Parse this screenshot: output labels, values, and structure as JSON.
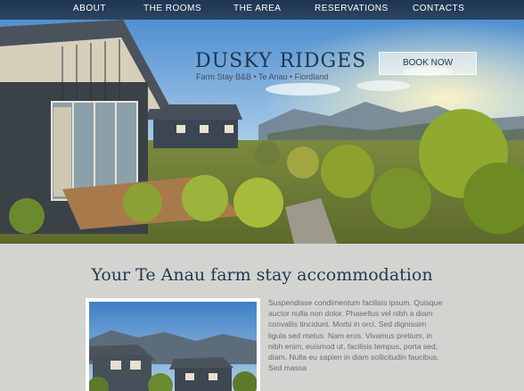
{
  "nav": {
    "items": [
      {
        "label": "ABOUT"
      },
      {
        "label": "THE ROOMS"
      },
      {
        "label": "THE AREA"
      },
      {
        "label": "RESERVATIONS"
      },
      {
        "label": "CONTACTS"
      }
    ]
  },
  "hero": {
    "title": "DUSKY RIDGES",
    "subtitle": "Farm Stay B&B • Te Anau • Fiordland",
    "book_label": "BOOK NOW"
  },
  "main": {
    "heading": "Your Te Anau farm stay accommodation",
    "paragraph": "Suspendisse condimentum facilisis ipsum. Quisque auctor nulla non dolor. Phasellus vel nibh a diam convallis tincidunt. Morbi in orci. Sed dignissim ligula sed metus. Nam eros. Vivamus pretium, in nibh enim, euismod ut, facilisis tempus, porta sed, diam. Nulla eu sapien in diam sollicitudin faucibus. Sed massa"
  },
  "colors": {
    "nav_bg": "#1f3550",
    "brand": "#1f3550",
    "page_bg": "#d3d4d0",
    "text": "#676e6e"
  }
}
